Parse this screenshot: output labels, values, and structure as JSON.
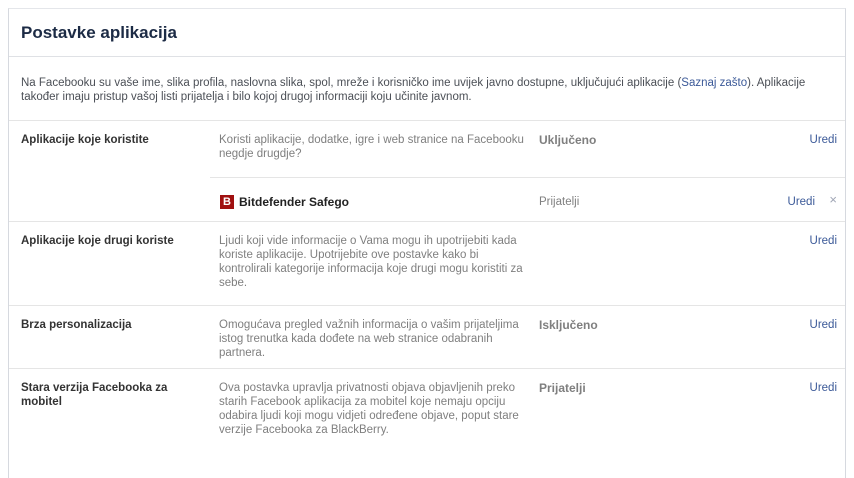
{
  "header": {
    "title": "Postavke aplikacija"
  },
  "intro": {
    "text_before": "Na Facebooku su vaše ime, slika profila, naslovna slika, spol, mreže i korisničko ime uvijek javno dostupne, uključujući aplikacije (",
    "link": "Saznaj zašto",
    "text_after": "). Aplikacije također imaju pristup vašoj listi prijatelja i bilo kojoj drugoj informaciji koju učinite javnom."
  },
  "rows": [
    {
      "label": "Aplikacije koje koristite",
      "desc": "Koristi aplikacije, dodatke, igre i web stranice na Facebooku negdje drugdje?",
      "status": "Uključeno",
      "edit": "Uredi",
      "apps": [
        {
          "icon": "bitdefender-icon",
          "icon_letter": "B",
          "name": "Bitdefender Safego",
          "audience": "Prijatelji",
          "edit": "Uredi",
          "remove": "×"
        }
      ]
    },
    {
      "label": "Aplikacije koje drugi koriste",
      "desc": "Ljudi koji vide informacije o Vama mogu ih upotrijebiti kada koriste aplikacije. Upotrijebite ove postavke kako bi kontrolirali kategorije informacija koje drugi mogu koristiti za sebe.",
      "status": "",
      "edit": "Uredi"
    },
    {
      "label": "Brza personalizacija",
      "desc": "Omogućava pregled važnih informacija o vašim prijateljima istog trenutka kada dođete na web stranice odabranih partnera.",
      "status": "Isključeno",
      "edit": "Uredi"
    },
    {
      "label": "Stara verzija Facebooka za mobitel",
      "desc": "Ova postavka upravlja privatnosti objava objavljenih preko starih Facebook aplikacija za mobitel koje nemaju opciju odabira ljudi koji mogu vidjeti određene objave, poput stare verzije Facebooka za BlackBerry.",
      "status": "Prijatelji",
      "edit": "Uredi"
    }
  ]
}
